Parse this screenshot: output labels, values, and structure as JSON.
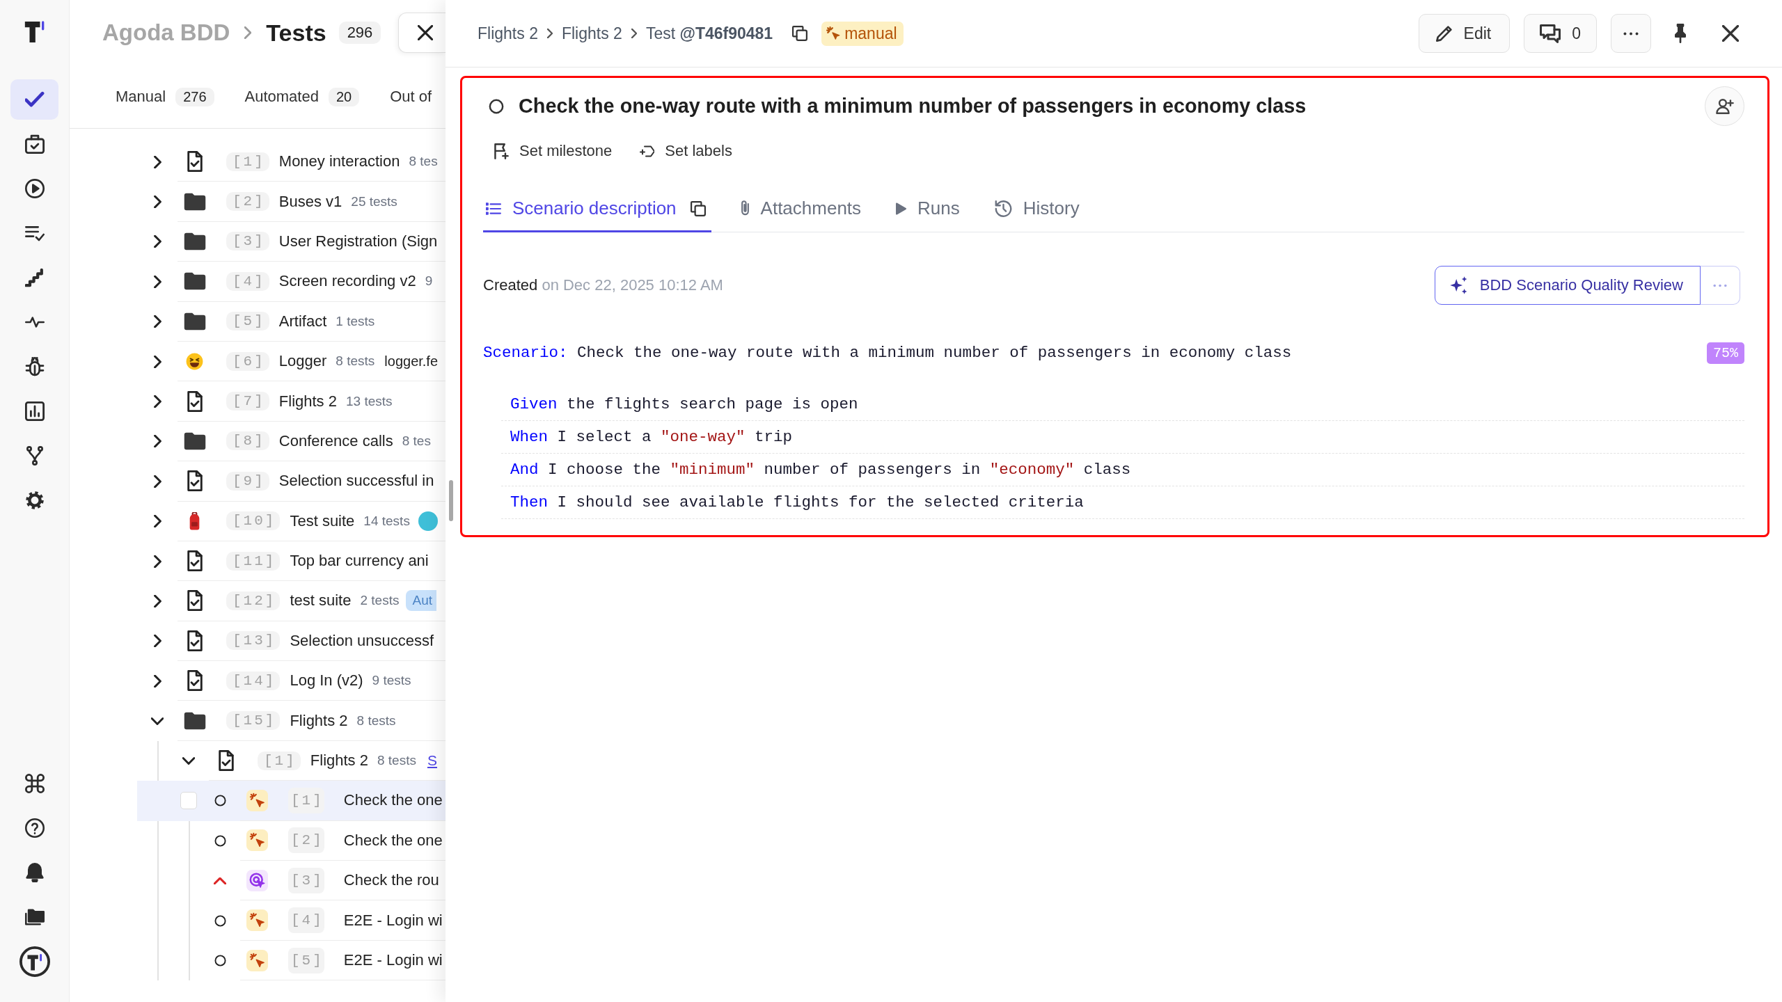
{
  "rail": {
    "top": [
      {
        "kind": "check",
        "selected": true
      },
      {
        "kind": "briefcase",
        "selected": false
      },
      {
        "kind": "play-circle",
        "selected": false
      },
      {
        "kind": "checklist",
        "selected": false
      },
      {
        "kind": "stairs",
        "selected": false
      },
      {
        "kind": "pulse",
        "selected": false
      },
      {
        "kind": "bug",
        "selected": false
      },
      {
        "kind": "bar-chart",
        "selected": false
      },
      {
        "kind": "fork",
        "selected": false
      },
      {
        "kind": "gear",
        "selected": false
      }
    ],
    "bottom": [
      {
        "kind": "command"
      },
      {
        "kind": "help"
      },
      {
        "kind": "bell"
      },
      {
        "kind": "folders"
      },
      {
        "kind": "round-logo"
      }
    ]
  },
  "project": {
    "name": "Agoda BDD",
    "page": "Tests",
    "count": "296"
  },
  "view_tabs": [
    {
      "label": "Manual",
      "count": "276"
    },
    {
      "label": "Automated",
      "count": "20"
    },
    {
      "label": "Out of"
    }
  ],
  "tree": {
    "items": [
      {
        "kind": "doc",
        "number": "[1]",
        "name": "Money interaction",
        "count": "8 tes",
        "expanded": false
      },
      {
        "kind": "folder",
        "number": "[2]",
        "name": "Buses v1",
        "count": "25 tests",
        "expanded": false
      },
      {
        "kind": "folder",
        "number": "[3]",
        "name": "User Registration (Sign",
        "expanded": false
      },
      {
        "kind": "folder",
        "number": "[4]",
        "name": "Screen recording v2",
        "count": "9",
        "expanded": false
      },
      {
        "kind": "folder",
        "number": "[5]",
        "name": "Artifact",
        "count": "1 tests",
        "expanded": false
      },
      {
        "kind": "laughing-emoji",
        "number": "[6]",
        "name": "Logger",
        "count": "8 tests",
        "note": "logger.fe",
        "expanded": false
      },
      {
        "kind": "doc",
        "number": "[7]",
        "name": "Flights 2",
        "count": "13 tests",
        "expanded": false
      },
      {
        "kind": "folder",
        "number": "[8]",
        "name": "Conference calls",
        "count": "8 tes",
        "expanded": false
      },
      {
        "kind": "doc",
        "number": "[9]",
        "name": "Selection successful in",
        "expanded": false
      },
      {
        "kind": "backpack",
        "number": "[10]",
        "name": "Test suite",
        "count": "14 tests",
        "image": true,
        "expanded": false
      },
      {
        "kind": "doc",
        "number": "[11]",
        "name": "Top bar currency ani",
        "expanded": false
      },
      {
        "kind": "doc",
        "number": "[12]",
        "name": "test suite",
        "count": "2 tests",
        "tag": "Aut",
        "expanded": false
      },
      {
        "kind": "doc",
        "number": "[13]",
        "name": "Selection unsuccessf",
        "expanded": false
      },
      {
        "kind": "doc",
        "number": "[14]",
        "name": "Log In (v2)",
        "count": "9 tests",
        "expanded": false
      },
      {
        "kind": "folder",
        "number": "[15]",
        "name": "Flights 2",
        "count": "8 tests",
        "expanded": true,
        "children": [
          {
            "kind": "doc",
            "number": "[1]",
            "name": "Flights 2",
            "count": "8 tests",
            "link": "S",
            "expanded": true,
            "children": [
              {
                "kind": "click-case",
                "number": "[1]",
                "name": "Check the one",
                "selected": true,
                "high_priority": false
              },
              {
                "kind": "click-case",
                "number": "[2]",
                "name": "Check the one",
                "selected": false,
                "high_priority": false
              },
              {
                "kind": "target-case",
                "number": "[3]",
                "name": "Check the rou",
                "selected": false,
                "high_priority": true
              },
              {
                "kind": "click-case",
                "number": "[4]",
                "name": "E2E - Login wi",
                "selected": false,
                "high_priority": false
              },
              {
                "kind": "click-case",
                "number": "[5]",
                "name": "E2E - Login wi",
                "selected": false,
                "high_priority": false
              }
            ]
          }
        ]
      }
    ]
  },
  "detail": {
    "breadcrumb": [
      "Flights 2",
      "Flights 2"
    ],
    "test_ref": "Test **@T46f90481**",
    "type_badge": "manual",
    "edit_label": "Edit",
    "comment_count": "0",
    "title": "Check the one-way route with a minimum number of passengers in economy class",
    "quick_actions": [
      {
        "kind": "milestone",
        "label": "Set milestone"
      },
      {
        "kind": "labels",
        "label": "Set labels"
      }
    ],
    "tabs": [
      {
        "kind": "list",
        "label": "Scenario description",
        "selected": true,
        "copyable": true
      },
      {
        "kind": "clip",
        "label": "Attachments",
        "selected": false
      },
      {
        "kind": "play",
        "label": "Runs",
        "selected": false
      },
      {
        "kind": "history",
        "label": "History",
        "selected": false
      }
    ],
    "created": {
      "label": "Created",
      "date": "on Dec 22, 2025 10:12 AM"
    },
    "review_button": "BDD Scenario Quality Review",
    "scenario": {
      "keyword": "Scenario:",
      "title": "Check the one-way route with a minimum number of passengers in economy class",
      "score": "75%",
      "steps": [
        {
          "keyword": "Given",
          "text": "the flights search page is open"
        },
        {
          "keyword": "When",
          "text": "I select a \"one-way\" trip"
        },
        {
          "keyword": "And",
          "text": "I choose the \"minimum\" number of passengers in \"economy\" class"
        },
        {
          "keyword": "Then",
          "text": "I should see available flights for the selected criteria"
        }
      ]
    }
  }
}
